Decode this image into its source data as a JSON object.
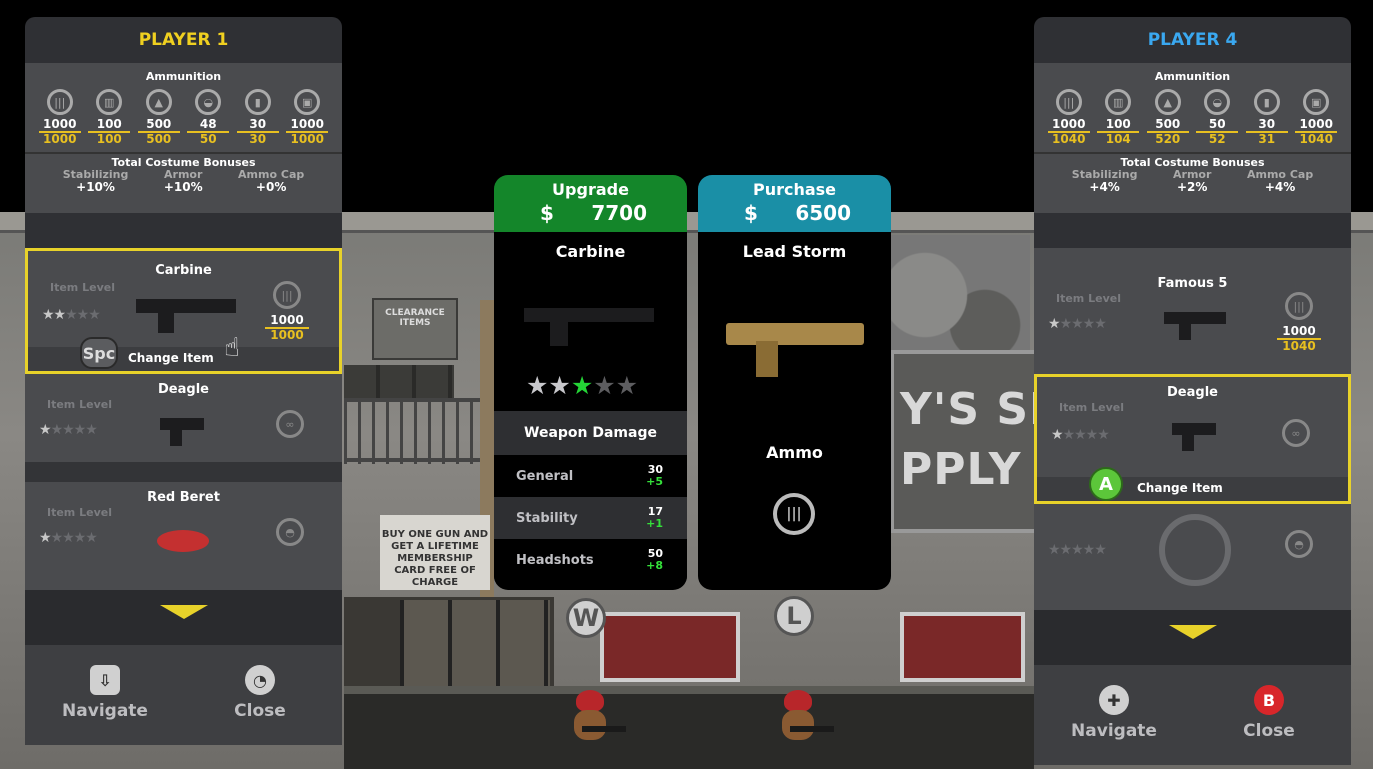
{
  "players": {
    "left": {
      "title": "PLAYER 1",
      "title_color": "#f0d020",
      "ammunition_label": "Ammunition",
      "ammo": [
        {
          "icon": "bullets-icon",
          "current": "1000",
          "max": "1000"
        },
        {
          "icon": "shells-icon",
          "current": "100",
          "max": "100"
        },
        {
          "icon": "flame-icon",
          "current": "500",
          "max": "500"
        },
        {
          "icon": "rocket-icon",
          "current": "48",
          "max": "50"
        },
        {
          "icon": "grenade-icon",
          "current": "30",
          "max": "30"
        },
        {
          "icon": "battery-icon",
          "current": "1000",
          "max": "1000"
        }
      ],
      "bonus_label": "Total Costume Bonuses",
      "bonuses": [
        {
          "label": "Stabilizing",
          "value": "+10%"
        },
        {
          "label": "Armor",
          "value": "+10%"
        },
        {
          "label": "Ammo Cap",
          "value": "+0%"
        }
      ],
      "slots": [
        {
          "name": "Carbine",
          "level_label": "Item Level",
          "stars": 2,
          "ammo_current": "1000",
          "ammo_max": "1000",
          "change_label": "Change Item",
          "key": "Spc",
          "selected": true
        },
        {
          "name": "Deagle",
          "level_label": "Item Level",
          "stars": 1,
          "ammo_icon": "infinity-icon"
        },
        {
          "name": "Red Beret",
          "level_label": "Item Level",
          "stars": 1,
          "ammo_icon": "helmet-icon"
        }
      ],
      "footer": {
        "navigate_label": "Navigate",
        "close_label": "Close"
      }
    },
    "right": {
      "title": "PLAYER 4",
      "title_color": "#3aa8f0",
      "ammunition_label": "Ammunition",
      "ammo": [
        {
          "icon": "bullets-icon",
          "current": "1000",
          "max": "1040"
        },
        {
          "icon": "shells-icon",
          "current": "100",
          "max": "104"
        },
        {
          "icon": "flame-icon",
          "current": "500",
          "max": "520"
        },
        {
          "icon": "rocket-icon",
          "current": "50",
          "max": "52"
        },
        {
          "icon": "grenade-icon",
          "current": "30",
          "max": "31"
        },
        {
          "icon": "battery-icon",
          "current": "1000",
          "max": "1040"
        }
      ],
      "bonus_label": "Total Costume Bonuses",
      "bonuses": [
        {
          "label": "Stabilizing",
          "value": "+4%"
        },
        {
          "label": "Armor",
          "value": "+2%"
        },
        {
          "label": "Ammo Cap",
          "value": "+4%"
        }
      ],
      "slots": [
        {
          "name": "Famous 5",
          "level_label": "Item Level",
          "stars": 1,
          "ammo_current": "1000",
          "ammo_max": "1040"
        },
        {
          "name": "Deagle",
          "level_label": "Item Level",
          "stars": 1,
          "ammo_icon": "infinity-icon",
          "change_label": "Change Item",
          "key": "A",
          "selected": true
        },
        {
          "name": "",
          "stars": 0,
          "ammo_icon": "helmet-icon"
        }
      ],
      "footer": {
        "navigate_label": "Navigate",
        "close_label": "Close",
        "close_key": "B"
      }
    }
  },
  "upgrade": {
    "title": "Upgrade",
    "currency": "$",
    "price": "7700",
    "item_name": "Carbine",
    "stars_current": 2,
    "stars_new": 1,
    "stars_total": 5,
    "damage_label": "Weapon Damage",
    "stats": [
      {
        "name": "General",
        "value": "30",
        "bonus": "+5"
      },
      {
        "name": "Stability",
        "value": "17",
        "bonus": "+1"
      },
      {
        "name": "Headshots",
        "value": "50",
        "bonus": "+8"
      }
    ]
  },
  "purchase": {
    "title": "Purchase",
    "currency": "$",
    "price": "6500",
    "item_name": "Lead Storm",
    "ammo_label": "Ammo"
  },
  "scene": {
    "store_sign_line1": "Y'S SP",
    "store_sign_line2": "PPLY S",
    "clearance_sign": "CLEARANCE ITEMS",
    "poster_text": "BUY ONE GUN AND GET A LIFETIME MEMBERSHIP CARD FREE OF CHARGE",
    "station_w": "W",
    "station_l": "L"
  },
  "colors": {
    "upgrade_header": "#14862a",
    "purchase_header": "#1a8fa6",
    "selected_border": "#e8d22a",
    "bonus_green": "#34e03a",
    "ammo_max_yellow": "#e8c020"
  }
}
